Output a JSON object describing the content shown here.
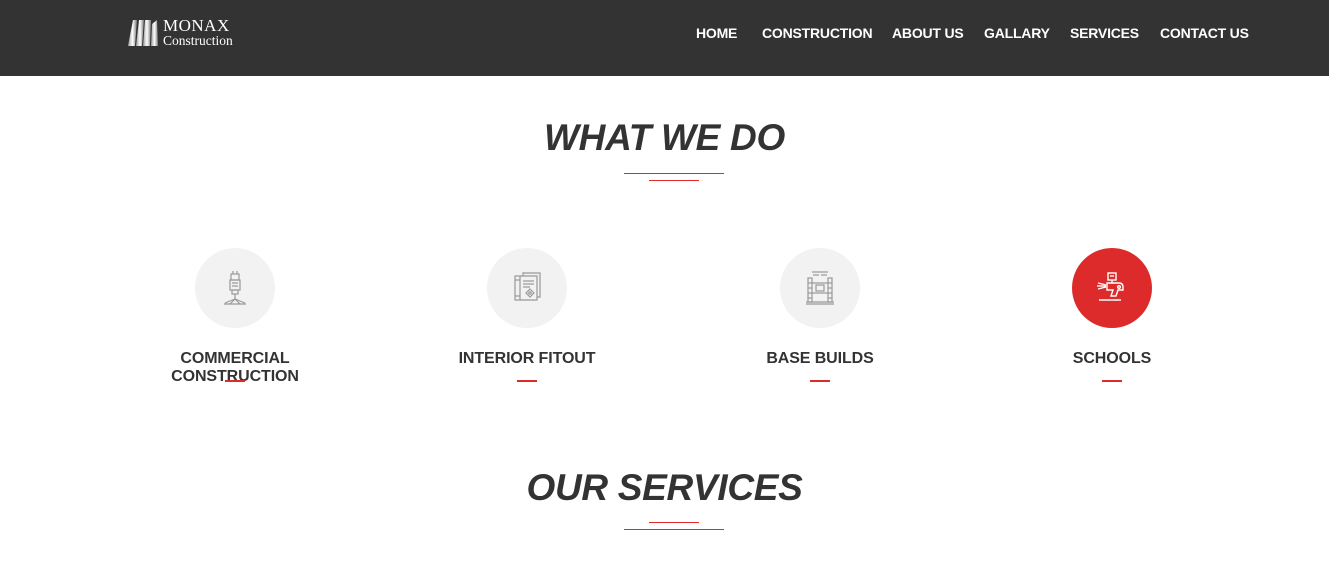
{
  "header": {
    "logo": {
      "name": "MONAX",
      "sub": "Construction"
    },
    "nav": [
      {
        "label": "HOME"
      },
      {
        "label": "CONSTRUCTION"
      },
      {
        "label": "ABOUT US"
      },
      {
        "label": "GALLARY"
      },
      {
        "label": "SERVICES"
      },
      {
        "label": "CONTACT US"
      }
    ]
  },
  "what_we_do": {
    "title": "WHAT WE DO",
    "items": [
      {
        "label": "COMMERCIAL CONSTRUCTION",
        "icon": "drill-icon",
        "active": false
      },
      {
        "label": "INTERIOR FITOUT",
        "icon": "blueprint-icon",
        "active": false
      },
      {
        "label": "BASE BUILDS",
        "icon": "building-frame-icon",
        "active": false
      },
      {
        "label": "SCHOOLS",
        "icon": "spray-gun-icon",
        "active": true
      }
    ]
  },
  "our_services": {
    "title": "OUR SERVICES"
  },
  "colors": {
    "accent": "#dd2b2b",
    "header_bg": "#333333",
    "text": "#333333",
    "icon_bg": "#f2f2f2"
  }
}
